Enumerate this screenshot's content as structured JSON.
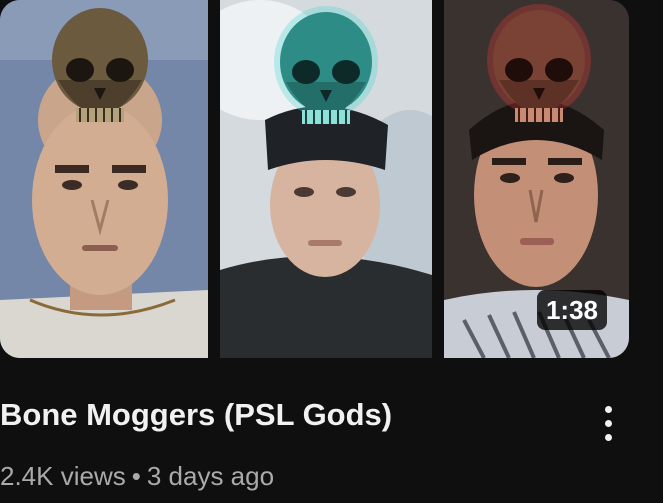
{
  "video": {
    "title": "Bone Moggers (PSL Gods)",
    "duration": "1:38",
    "views": "2.4K views",
    "separator": "•",
    "age": "3 days ago"
  },
  "thumbnail": {
    "panels": [
      {
        "skull_tint": "bronze",
        "background": "#6f7f9e"
      },
      {
        "skull_tint": "teal-glow",
        "background": "#cfd6dc"
      },
      {
        "skull_tint": "red-glow",
        "background": "#3c3431"
      }
    ]
  },
  "icons": {
    "menu": "more-vertical-icon"
  }
}
